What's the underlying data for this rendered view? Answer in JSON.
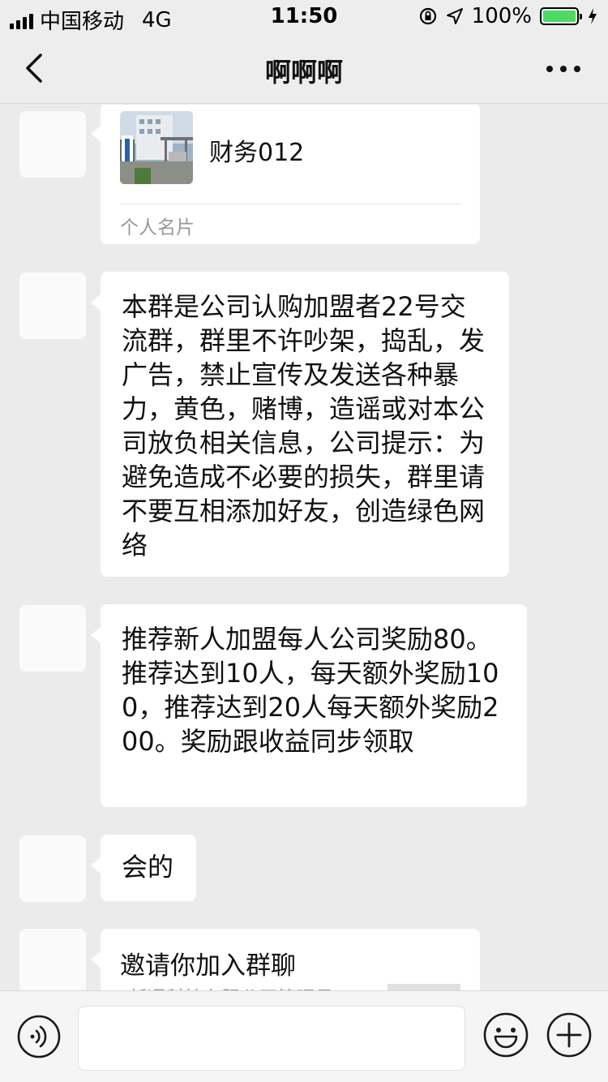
{
  "status_bar": {
    "carrier": "中国移动",
    "network": "4G",
    "time": "11:50",
    "battery": "100%"
  },
  "nav": {
    "title": "啊啊啊",
    "back_icon": "chevron-left-icon",
    "more_icon": "more-dots-icon"
  },
  "messages": [
    {
      "type": "card",
      "name": "财务012",
      "footer": "个人名片"
    },
    {
      "type": "text",
      "text": "本群是公司认购加盟者22号交流群，群里不许吵架，捣乱，发广告，禁止宣传及发送各种暴力，黄色，赌博，造谣或对本公司放负相关信息，公司提示：为避免造成不必要的损失，群里请不要互相添加好友，创造绿色网络"
    },
    {
      "type": "text",
      "text": "推荐新人加盟每人公司奖励80。推荐达到10人，每天额外奖励100，推荐达到20人每天额外奖励200。奖励跟收益同步领取"
    },
    {
      "type": "text",
      "text": "会的"
    },
    {
      "type": "invite",
      "title": "邀请你加入群聊",
      "desc": "\"新通科技有限公司管理员"
    }
  ],
  "input_bar": {
    "voice_icon": "voice-icon",
    "emoji_icon": "emoji-icon",
    "plus_icon": "plus-icon",
    "placeholder": ""
  },
  "colors": {
    "chat_background": "#ebebeb",
    "bubble": "#ffffff",
    "battery": "#4cd964"
  }
}
